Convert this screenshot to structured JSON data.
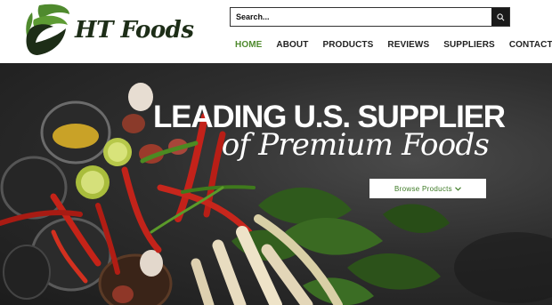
{
  "brand": {
    "name": "HT Foods",
    "colors": {
      "green": "#4f8a2e",
      "dark": "#1d2d17"
    }
  },
  "search": {
    "placeholder": "Search...",
    "icon": "search-icon"
  },
  "nav": {
    "items": [
      {
        "label": "HOME",
        "active": true
      },
      {
        "label": "ABOUT",
        "active": false
      },
      {
        "label": "PRODUCTS",
        "active": false
      },
      {
        "label": "REVIEWS",
        "active": false
      },
      {
        "label": "SUPPLIERS",
        "active": false
      },
      {
        "label": "CONTACT",
        "active": false
      }
    ]
  },
  "hero": {
    "headline_line1": "LEADING U.S. SUPPLIER",
    "headline_line2": "of Premium Foods",
    "cta_label": "Browse Products",
    "cta_icon": "chevron-down-icon"
  }
}
